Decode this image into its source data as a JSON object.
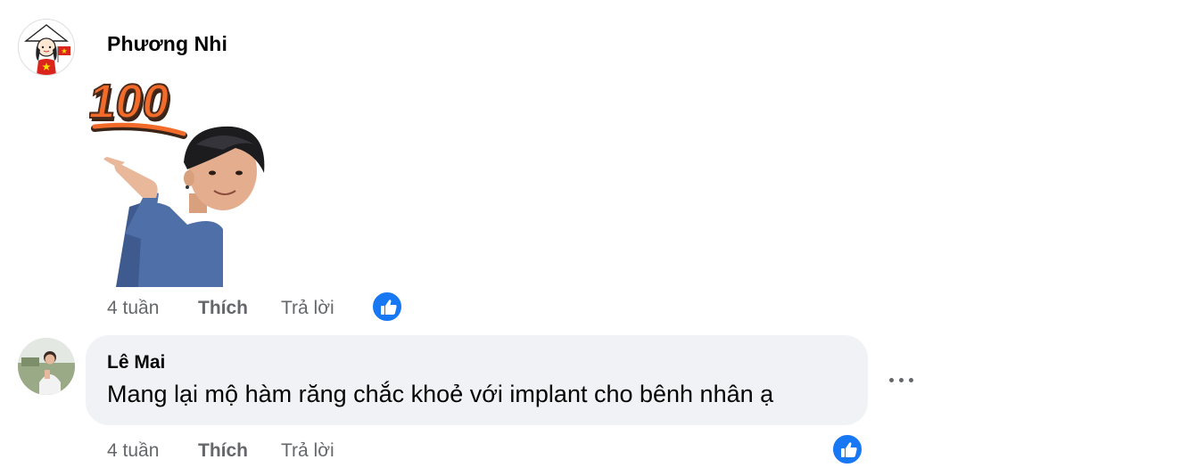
{
  "comments": [
    {
      "author": "Phương Nhi",
      "sticker": {
        "label": "100",
        "icon": "pointing-man-100-sticker"
      },
      "time": "4 tuần",
      "like_label": "Thích",
      "reply_label": "Trả lời",
      "reaction_icon": "like-reaction-icon"
    },
    {
      "author": "Lê Mai",
      "text": "Mang lại mộ hàm răng chắc khoẻ với implant cho bênh nhân ạ",
      "time": "4 tuần",
      "like_label": "Thích",
      "reply_label": "Trả lời",
      "reaction_icon": "like-reaction-icon",
      "more_icon": "more-options-icon"
    }
  ],
  "colors": {
    "bubble_bg": "#f0f2f5",
    "secondary_text": "#65676b",
    "like_blue": "#1877f2",
    "sticker_orange": "#f26b2a"
  }
}
